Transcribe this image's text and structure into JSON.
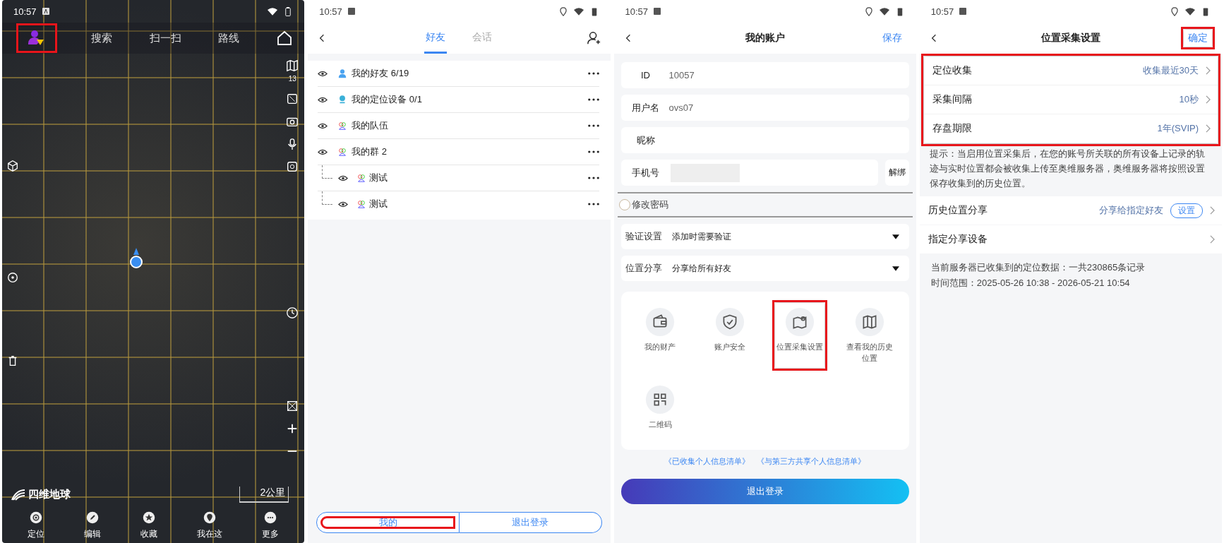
{
  "map_screen": {
    "status_bar": {
      "time": "10:57"
    },
    "top_bar": {
      "avatar_highlighted": true,
      "items": [
        "搜索",
        "扫一扫",
        "路线"
      ]
    },
    "zoom_level": "13",
    "logo": "四维地球",
    "scale": "2公里",
    "bottom_nav": [
      {
        "label": "定位",
        "kind": "target"
      },
      {
        "label": "编辑",
        "kind": "pencil"
      },
      {
        "label": "收藏",
        "kind": "star"
      },
      {
        "label": "我在这",
        "kind": "pin"
      },
      {
        "label": "更多",
        "kind": "more"
      }
    ]
  },
  "friends_screen": {
    "status_bar": {
      "time": "10:57"
    },
    "tabs": [
      {
        "label": "好友",
        "selected": true
      },
      {
        "label": "会话",
        "selected": false
      }
    ],
    "groups": [
      {
        "label": "我的好友 6/19",
        "kind": "person"
      },
      {
        "label": "我的定位设备 0/1",
        "kind": "device"
      },
      {
        "label": "我的队伍",
        "kind": "group"
      },
      {
        "label": "我的群 2",
        "kind": "group",
        "children": [
          {
            "label": "测试"
          },
          {
            "label": "测试"
          }
        ]
      }
    ],
    "bottom_buttons": [
      {
        "label": "我的",
        "highlighted": true
      },
      {
        "label": "退出登录",
        "highlighted": false
      }
    ]
  },
  "account_screen": {
    "status_bar": {
      "time": "10:57"
    },
    "title": "我的账户",
    "save": "保存",
    "fields": [
      {
        "label": "ID",
        "value": "10057"
      },
      {
        "label": "用户名",
        "value": "ovs07"
      },
      {
        "label": "昵称"
      },
      {
        "label": "手机号",
        "masked": true,
        "action": "解绑"
      }
    ],
    "change_password": {
      "label": "修改密码",
      "checked": false
    },
    "selects": [
      {
        "label": "验证设置",
        "value": "添加时需要验证"
      },
      {
        "label": "位置分享",
        "value": "分享给所有好友"
      }
    ],
    "tiles": [
      {
        "label": "我的财产",
        "kind": "wallet",
        "highlighted": false
      },
      {
        "label": "账户安全",
        "kind": "shield",
        "highlighted": false
      },
      {
        "label": "位置采集设置",
        "kind": "location",
        "highlighted": true
      },
      {
        "label": "查看我的历史位置",
        "kind": "history",
        "highlighted": false
      },
      {
        "label": "二维码",
        "kind": "qr",
        "highlighted": false
      }
    ],
    "links": [
      "《已收集个人信息清单》",
      "《与第三方共享个人信息清单》"
    ],
    "logout": "退出登录"
  },
  "settings_screen": {
    "status_bar": {
      "time": "10:57"
    },
    "title": "位置采集设置",
    "confirm": {
      "label": "确定",
      "highlighted": true
    },
    "collection": {
      "highlighted": true,
      "rows": [
        {
          "label": "定位收集",
          "value": "收集最近30天"
        },
        {
          "label": "采集间隔",
          "value": "10秒"
        },
        {
          "label": "存盘期限",
          "value": "1年(SVIP)"
        }
      ]
    },
    "hint": "提示：当启用位置采集后，在您的账号所关联的所有设备上记录的轨迹与实时位置都会被收集上传至奥维服务器，奥维服务器将按照设置保存收集到的历史位置。",
    "share_rows": [
      {
        "label": "历史位置分享",
        "value": "分享给指定好友",
        "badge": "设置"
      },
      {
        "label": "指定分享设备"
      }
    ],
    "info": [
      "当前服务器已收集到的定位数据：一共230865条记录",
      "时间范围：2025-05-26 10:38 - 2026-05-21 10:54"
    ]
  }
}
